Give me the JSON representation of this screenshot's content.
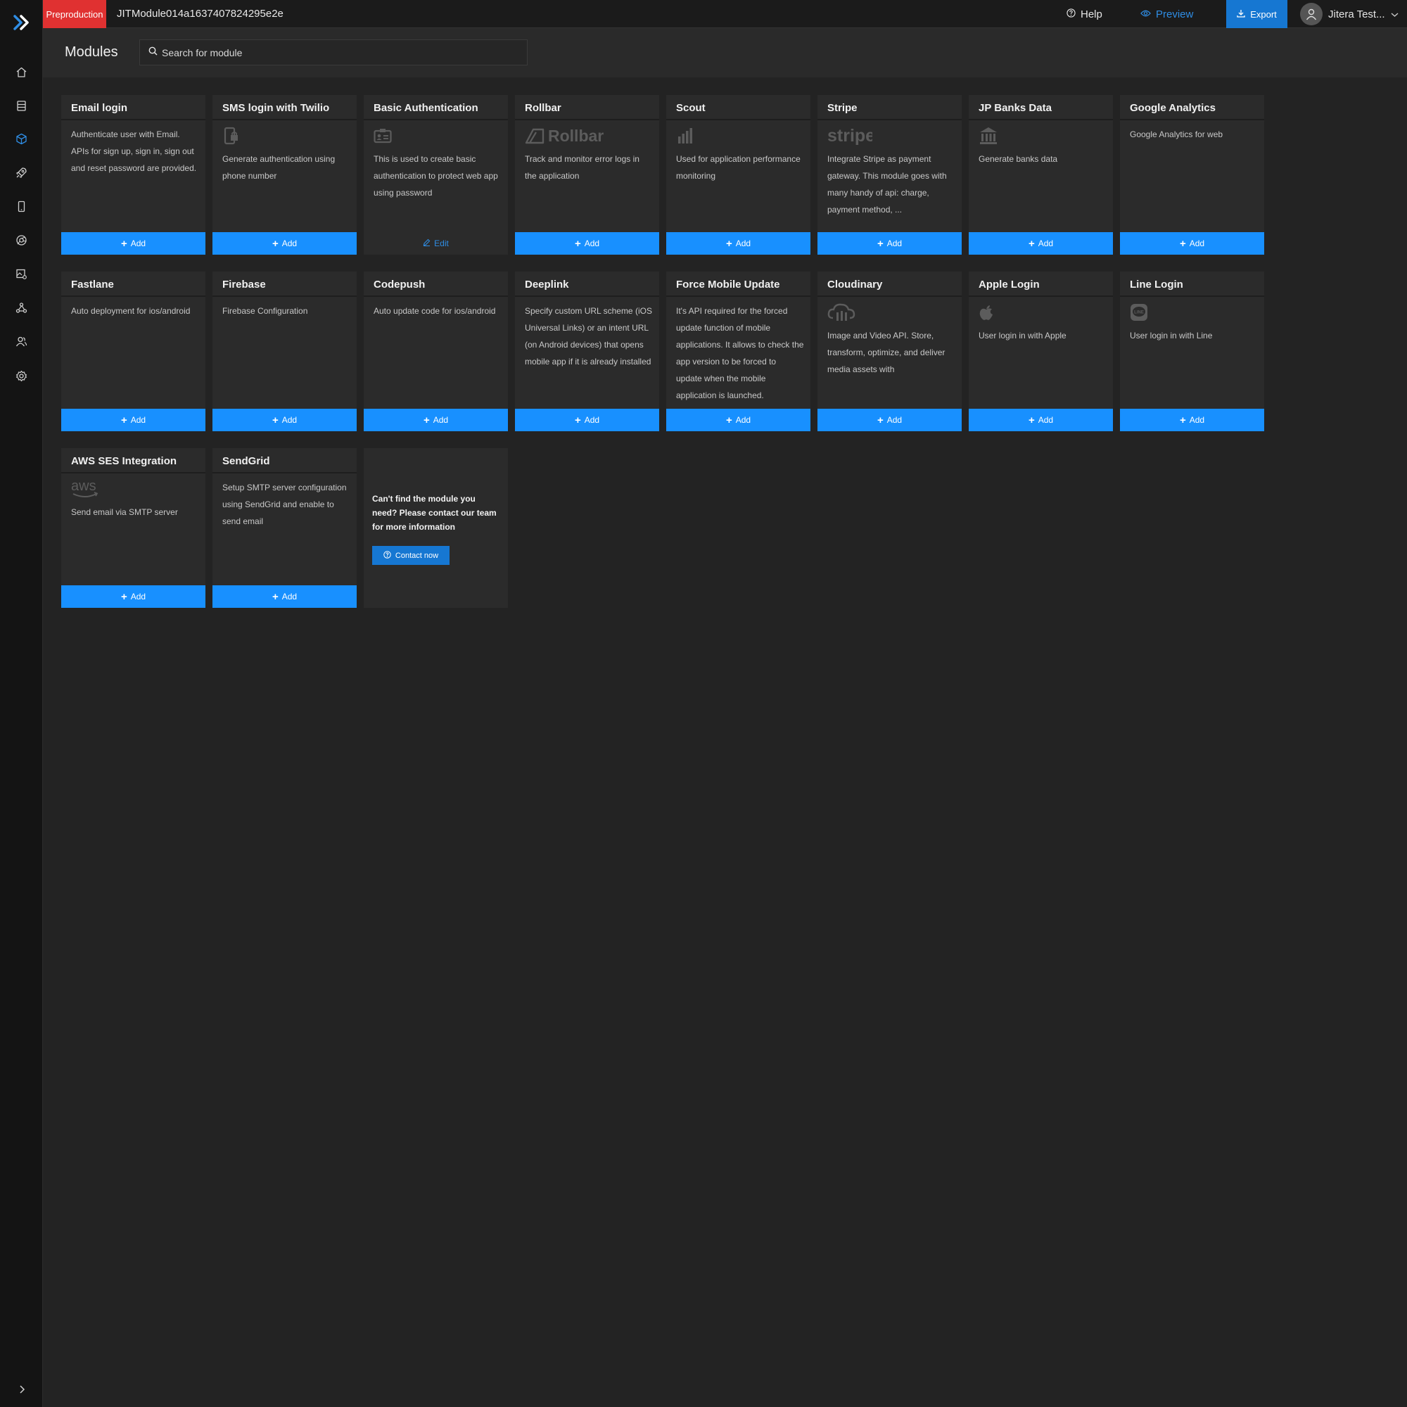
{
  "topbar": {
    "env_badge": "Preproduction",
    "project_name": "JITModule014a1637407824295e2e",
    "help_label": "Help",
    "preview_label": "Preview",
    "export_label": "Export",
    "user_name": "Jitera Test..."
  },
  "sidebar": {
    "items": [
      {
        "icon": "home-icon"
      },
      {
        "icon": "database-icon"
      },
      {
        "icon": "modules-icon",
        "active": true
      },
      {
        "icon": "rocket-icon"
      },
      {
        "icon": "mobile-icon"
      },
      {
        "icon": "browser-icon"
      },
      {
        "icon": "image-settings-icon"
      },
      {
        "icon": "webhook-icon"
      },
      {
        "icon": "team-icon"
      },
      {
        "icon": "settings-icon"
      }
    ]
  },
  "header": {
    "title": "Modules",
    "search_placeholder": "Search for module"
  },
  "modules": [
    {
      "title": "Email login",
      "description": "Authenticate user with Email. APIs for sign up, sign in, sign out and reset password are provided.",
      "logo": "",
      "action": "Add"
    },
    {
      "title": "SMS login with Twilio",
      "description": "Generate authentication using phone number",
      "logo": "phone-lock-icon",
      "action": "Add"
    },
    {
      "title": "Basic Authentication",
      "description": "This is used to create basic authentication to protect web app using password",
      "logo": "id-card-icon",
      "action": "Edit"
    },
    {
      "title": "Rollbar",
      "description": "Track and monitor error logs in the application",
      "logo": "rollbar-logo",
      "logo_text": "Rollbar",
      "action": "Add"
    },
    {
      "title": "Scout",
      "description": "Used for application performance monitoring",
      "logo": "scout-logo",
      "action": "Add"
    },
    {
      "title": "Stripe",
      "description": "Integrate Stripe as payment gateway. This module goes with many handy of api: charge, payment method, ...",
      "logo": "stripe-logo",
      "logo_text": "stripe",
      "action": "Add"
    },
    {
      "title": "JP Banks Data",
      "description": "Generate banks data",
      "logo": "bank-icon",
      "action": "Add"
    },
    {
      "title": "Google Analytics",
      "description": "Google Analytics for web",
      "logo": "",
      "action": "Add"
    },
    {
      "title": "Fastlane",
      "description": "Auto deployment for ios/android",
      "logo": "",
      "action": "Add"
    },
    {
      "title": "Firebase",
      "description": "Firebase Configuration",
      "logo": "",
      "action": "Add"
    },
    {
      "title": "Codepush",
      "description": "Auto update code for ios/android",
      "logo": "",
      "action": "Add"
    },
    {
      "title": "Deeplink",
      "description": "Specify custom URL scheme (iOS Universal Links) or an intent URL (on Android devices) that opens mobile app if it is already installed",
      "logo": "",
      "action": "Add"
    },
    {
      "title": "Force Mobile Update",
      "description": "It's API required for the forced update function of mobile applications. It allows to check the app version to be forced to update when the mobile application is launched.",
      "logo": "",
      "action": "Add"
    },
    {
      "title": "Cloudinary",
      "description": "Image and Video API. Store, transform, optimize, and deliver media assets with",
      "logo": "cloudinary-logo",
      "action": "Add"
    },
    {
      "title": "Apple Login",
      "description": "User login in with Apple",
      "logo": "apple-icon",
      "action": "Add"
    },
    {
      "title": "Line Login",
      "description": "User login in with Line",
      "logo": "line-icon",
      "logo_text": "LINE",
      "action": "Add"
    },
    {
      "title": "AWS SES Integration",
      "description": "Send email via SMTP server",
      "logo": "aws-logo",
      "logo_text": "aws",
      "action": "Add"
    },
    {
      "title": "SendGrid",
      "description": "Setup SMTP server configuration using SendGrid and enable to send email",
      "logo": "",
      "action": "Add"
    }
  ],
  "contact": {
    "message": "Can't find the module you need? Please contact our team for more information",
    "button_label": "Contact now"
  },
  "colors": {
    "accent": "#1890ff",
    "badge": "#e03131",
    "background": "#232323",
    "card": "#2b2b2b"
  }
}
